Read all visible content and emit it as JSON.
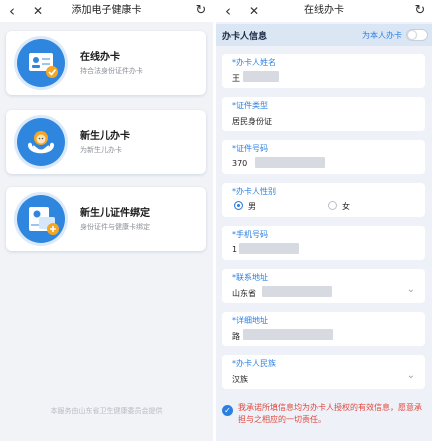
{
  "left": {
    "nav": {
      "back_icon": "‹",
      "close_icon": "✕",
      "title": "添加电子健康卡",
      "refresh_icon": "↻"
    },
    "cards": [
      {
        "title": "在线办卡",
        "subtitle": "持合法身份证件办卡",
        "icon": "id-card-icon"
      },
      {
        "title": "新生儿办卡",
        "subtitle": "为新生儿办卡",
        "icon": "newborn-icon"
      },
      {
        "title": "新生儿证件绑定",
        "subtitle": "身份证件与健康卡绑定",
        "icon": "bind-card-icon"
      }
    ],
    "footer": "本服务由山东省卫生健康委员会提供"
  },
  "right": {
    "nav": {
      "back_icon": "‹",
      "close_icon": "✕",
      "title": "在线办卡",
      "refresh_icon": "↻"
    },
    "section_title": "办卡人信息",
    "self_apply_label": "为本人办卡",
    "fields": {
      "name": {
        "label": "*办卡人姓名",
        "value": "王"
      },
      "id_type": {
        "label": "*证件类型",
        "value": "居民身份证"
      },
      "id_number": {
        "label": "*证件号码",
        "value": "370"
      },
      "gender": {
        "label": "*办卡人性别",
        "options": [
          "男",
          "女"
        ],
        "selected": "男"
      },
      "phone": {
        "label": "*手机号码",
        "value": "1"
      },
      "address": {
        "label": "*联系地址",
        "value": "山东省"
      },
      "detail_address": {
        "label": "*详细地址",
        "value": "路"
      },
      "ethnicity": {
        "label": "*办卡人民族",
        "value": "汉族"
      }
    },
    "agreement": "我承诺所填信息均为办卡人授权的有效信息，愿意承担与之相应的一切责任。"
  },
  "colors": {
    "accent": "#2b7fe0",
    "warning_text": "#e0463c",
    "section_bg": "#dbe6f5"
  }
}
